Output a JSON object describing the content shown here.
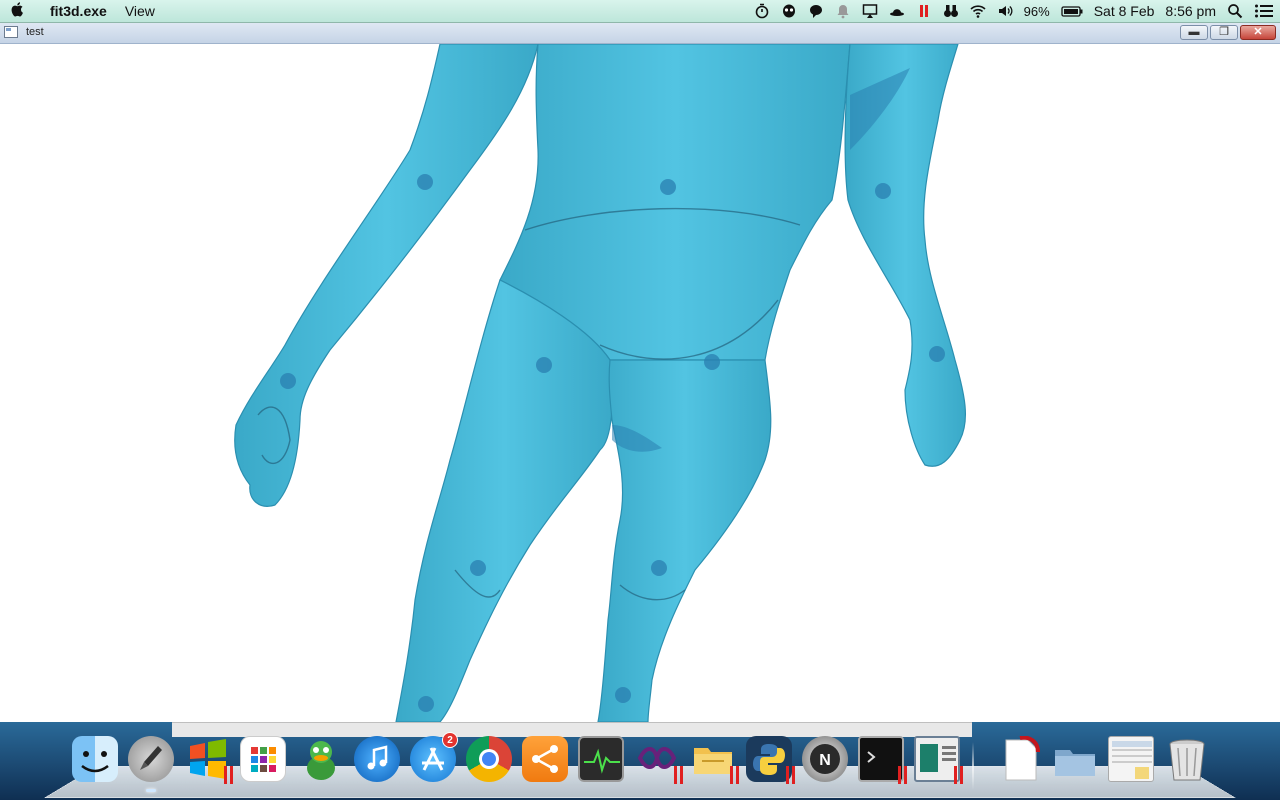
{
  "menubar": {
    "app_name": "fit3d.exe",
    "menus": [
      "View"
    ],
    "status_icons": [
      "timer-icon",
      "alien-icon",
      "chat-bubble-icon",
      "notification-bell-icon",
      "airplay-screen-icon",
      "bowler-hat-icon",
      "parallels-pause-icon",
      "binoculars-icon",
      "wifi-icon",
      "volume-icon"
    ],
    "battery_percent": "96%",
    "date": "Sat 8 Feb",
    "time": "8:56 pm"
  },
  "window": {
    "title": "test"
  },
  "dock": {
    "items": [
      {
        "name": "finder",
        "paused": false,
        "running": false
      },
      {
        "name": "launchpad",
        "paused": false,
        "running": true
      },
      {
        "name": "windows",
        "paused": true,
        "running": false
      },
      {
        "name": "app-grid",
        "paused": false,
        "running": false
      },
      {
        "name": "adium",
        "paused": false,
        "running": false
      },
      {
        "name": "itunes",
        "paused": false,
        "running": false
      },
      {
        "name": "app-store",
        "paused": false,
        "running": false,
        "badge": "2"
      },
      {
        "name": "chrome",
        "paused": false,
        "running": false
      },
      {
        "name": "share",
        "paused": false,
        "running": false
      },
      {
        "name": "activity-monitor",
        "paused": false,
        "running": false
      },
      {
        "name": "visual-studio",
        "paused": true,
        "running": false
      },
      {
        "name": "windows-explorer",
        "paused": true,
        "running": false
      },
      {
        "name": "python",
        "paused": true,
        "running": false
      },
      {
        "name": "network-status",
        "paused": false,
        "running": false
      },
      {
        "name": "terminal",
        "paused": true,
        "running": false
      },
      {
        "name": "preview-window",
        "paused": true,
        "running": false
      },
      {
        "name": "pdf-document",
        "paused": false,
        "running": false
      },
      {
        "name": "applications-folder",
        "paused": false,
        "running": false
      },
      {
        "name": "documents-stack",
        "paused": false,
        "running": false
      },
      {
        "name": "trash",
        "paused": false,
        "running": false
      }
    ]
  },
  "colors": {
    "mesh": "#49bfdc",
    "marker": "#2a7fb0",
    "menubar": "#c9ece1"
  }
}
